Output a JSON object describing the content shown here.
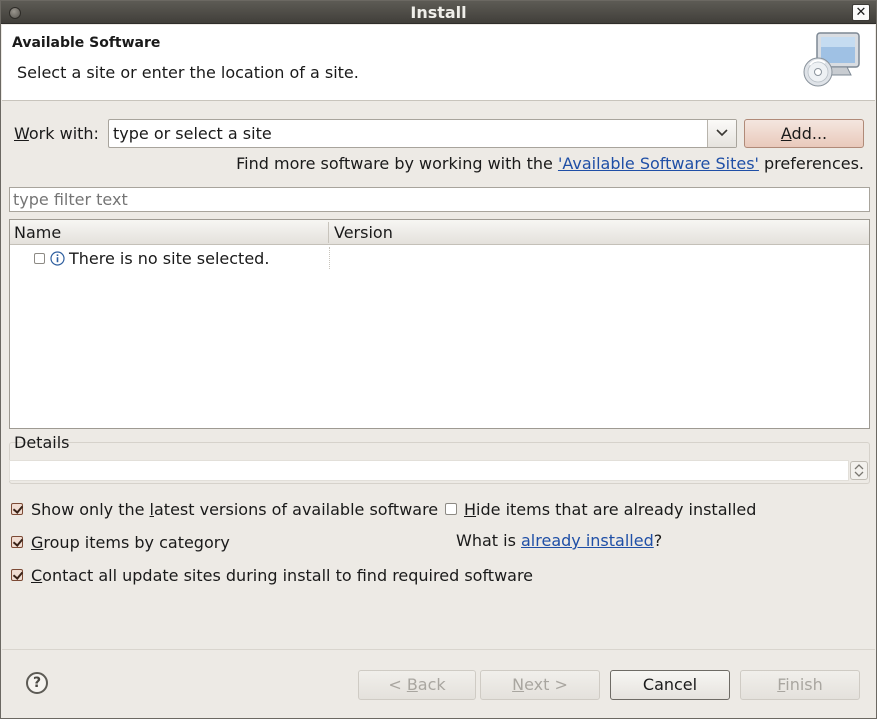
{
  "window": {
    "title": "Install"
  },
  "header": {
    "title": "Available Software",
    "description": "Select a site or enter the location of a site."
  },
  "work_with": {
    "label_mnemonic": "W",
    "label_rest": "ork with:",
    "value": "type or select a site",
    "add_mnemonic": "A",
    "add_rest": "dd..."
  },
  "find_more": {
    "prefix": "Find more software by working with the ",
    "link": "'Available Software Sites'",
    "suffix": " preferences."
  },
  "filter": {
    "placeholder": "type filter text"
  },
  "table": {
    "columns": [
      "Name",
      "Version"
    ],
    "rows": [
      {
        "name": "There is no site selected.",
        "version": "",
        "checked": false,
        "icon": "info-icon"
      }
    ]
  },
  "details": {
    "label": "Details"
  },
  "options": {
    "show_latest": {
      "pre": "Show only the ",
      "mnemonic": "l",
      "post": "atest versions of available software",
      "checked": true
    },
    "hide_installed": {
      "pre": "",
      "mnemonic": "H",
      "post": "ide items that are already installed",
      "checked": false
    },
    "group_by_category": {
      "pre": "",
      "mnemonic": "G",
      "post": "roup items by category",
      "checked": true
    },
    "contact_sites": {
      "pre": "",
      "mnemonic": "C",
      "post": "ontact all update sites during install to find required software",
      "checked": true
    },
    "what_is_prefix": "What is ",
    "what_is_link": "already installed",
    "what_is_suffix": "?"
  },
  "footer": {
    "help": "?",
    "back": {
      "pre": "< ",
      "mnemonic": "B",
      "post": "ack",
      "enabled": false
    },
    "next": {
      "pre": "",
      "mnemonic": "N",
      "post": "ext >",
      "enabled": false
    },
    "cancel": "Cancel",
    "finish": {
      "pre": "",
      "mnemonic": "F",
      "post": "inish",
      "enabled": false
    }
  },
  "colors": {
    "titlebar": "#4a4843",
    "window_bg": "#edeae5",
    "link": "#1f4fa6",
    "default_button": "#e9c9bb"
  }
}
